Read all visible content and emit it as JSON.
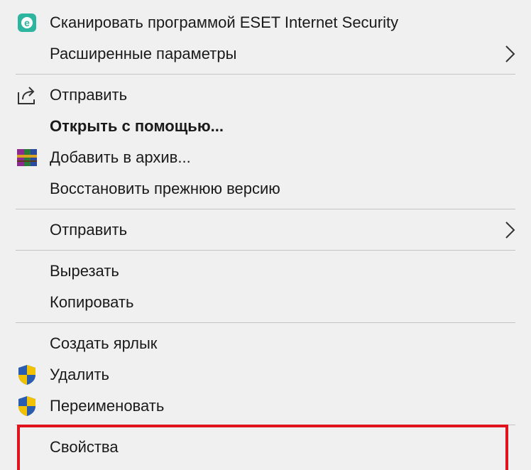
{
  "menu": {
    "items": [
      {
        "label": "Сканировать программой ESET Internet Security",
        "icon": "eset-icon"
      },
      {
        "label": "Расширенные параметры",
        "icon": "chevron-right-icon"
      },
      {
        "label": "Отправить",
        "icon": "share-icon"
      },
      {
        "label": "Открыть с помощью..."
      },
      {
        "label": "Добавить в архив...",
        "icon": "winrar-icon"
      },
      {
        "label": "Восстановить прежнюю версию"
      },
      {
        "label": "Отправить",
        "icon": "chevron-right-icon"
      },
      {
        "label": "Вырезать"
      },
      {
        "label": "Копировать"
      },
      {
        "label": "Создать ярлык"
      },
      {
        "label": "Удалить",
        "icon": "uac-shield-icon"
      },
      {
        "label": "Переименовать",
        "icon": "uac-shield-icon"
      },
      {
        "label": "Свойства"
      }
    ]
  },
  "colors": {
    "menu_background": "#f0f0f0",
    "separator": "#c4c4c4",
    "highlight_border": "#e0141e",
    "eset_accent": "#2eb5a0"
  }
}
